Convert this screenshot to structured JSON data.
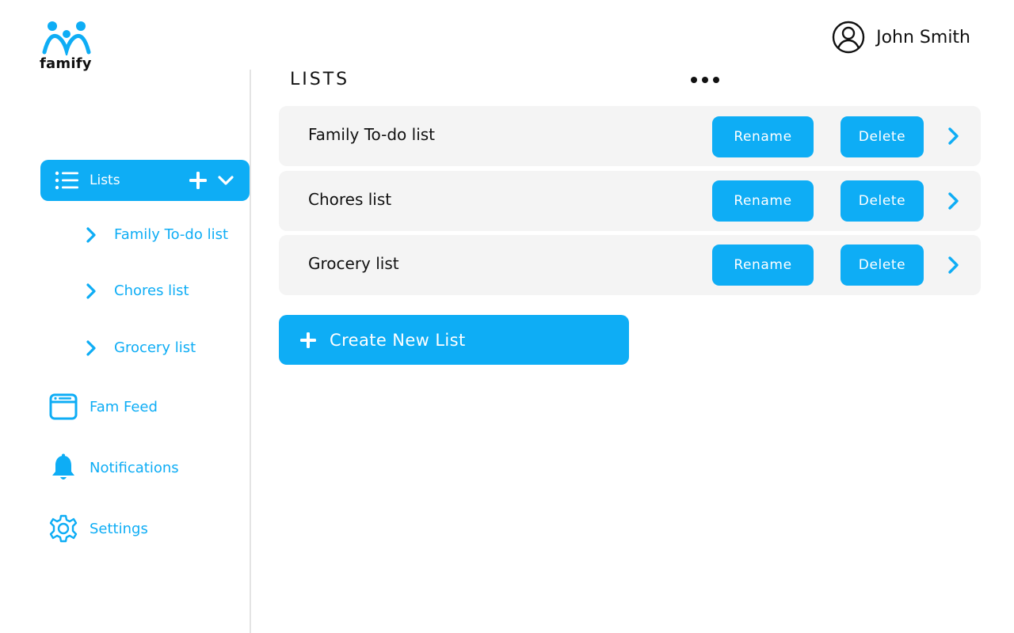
{
  "app": {
    "logo_text": "famify"
  },
  "user": {
    "name": "John Smith"
  },
  "sidebar": {
    "lists_label": "Lists",
    "sub_lists": [
      {
        "label": "Family To-do list"
      },
      {
        "label": "Chores list"
      },
      {
        "label": "Grocery list"
      }
    ],
    "items": [
      {
        "label": "Fam Feed",
        "icon": "browser-window-icon"
      },
      {
        "label": "Notifications",
        "icon": "bell-icon"
      },
      {
        "label": "Settings",
        "icon": "gear-icon"
      }
    ]
  },
  "main": {
    "title": "LISTS",
    "lists": [
      {
        "name": "Family To-do list",
        "rename_label": "Rename",
        "delete_label": "Delete"
      },
      {
        "name": "Chores list",
        "rename_label": "Rename",
        "delete_label": "Delete"
      },
      {
        "name": "Grocery list",
        "rename_label": "Rename",
        "delete_label": "Delete"
      }
    ],
    "create_label": "Create New List"
  },
  "colors": {
    "accent": "#0eadf5",
    "row_bg": "#f4f4f4",
    "text": "#111111"
  }
}
